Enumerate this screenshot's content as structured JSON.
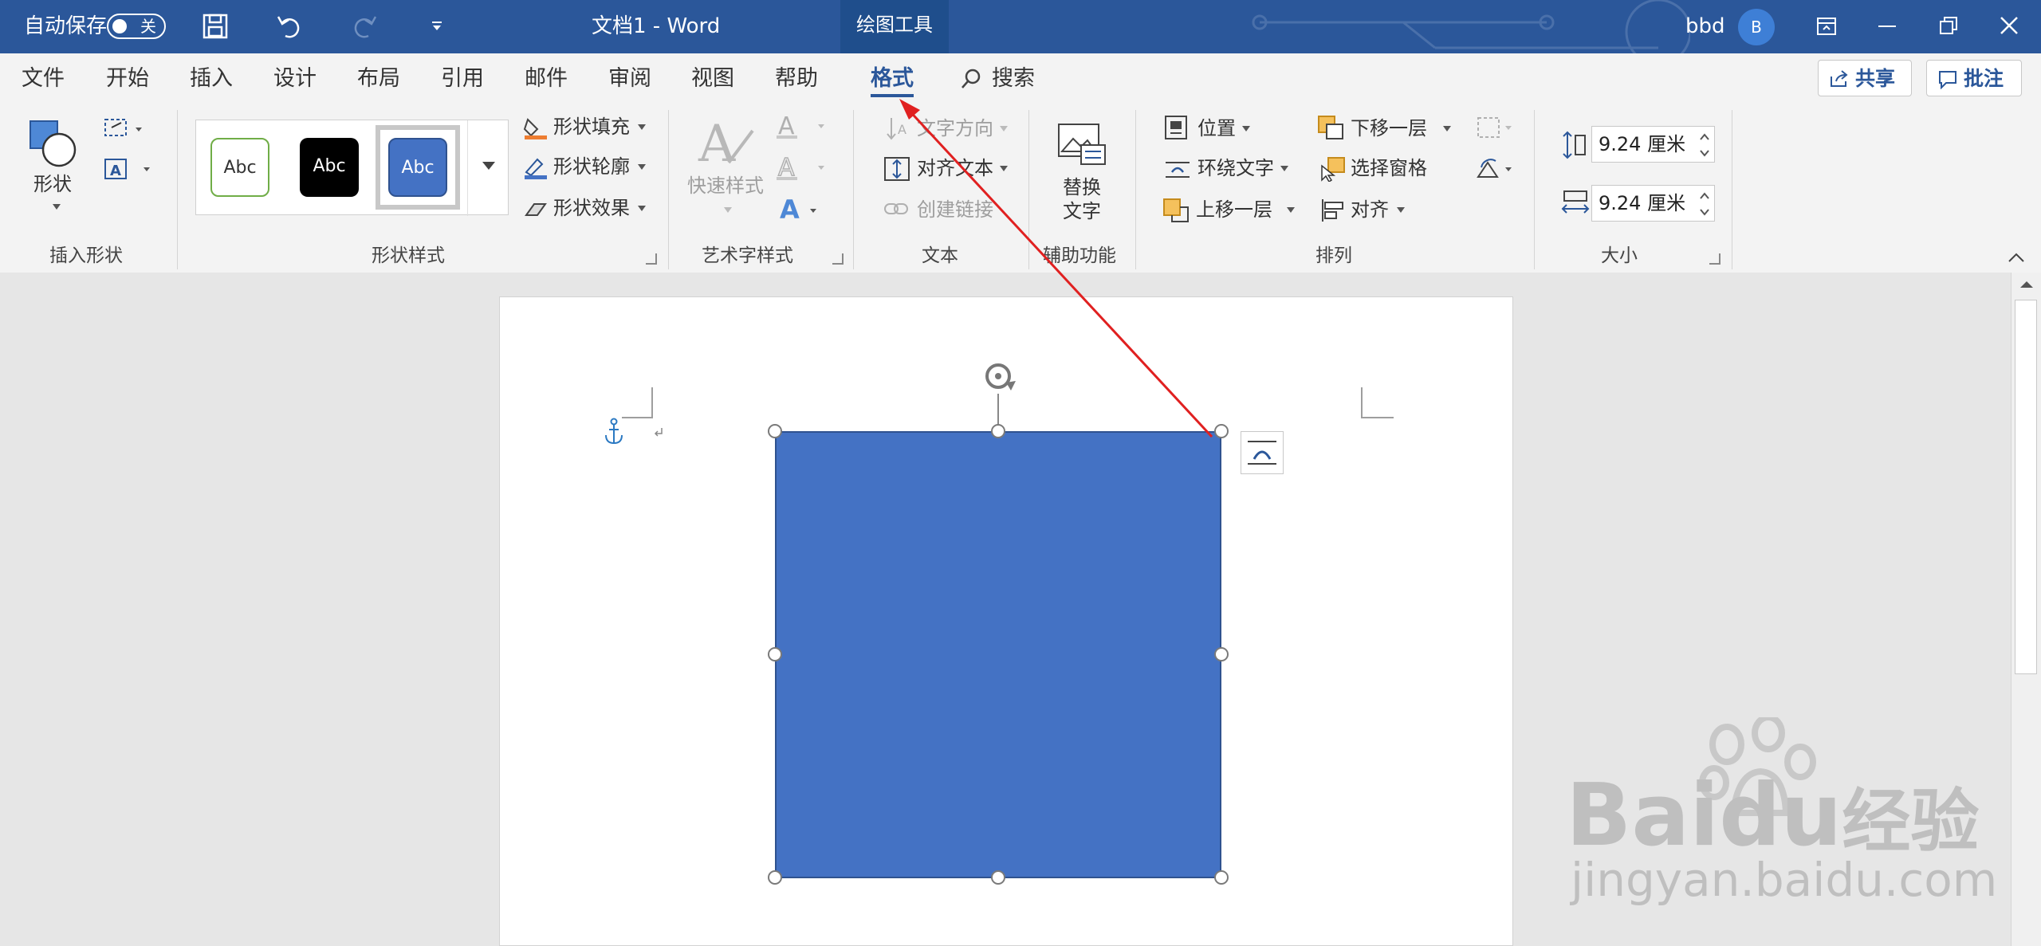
{
  "titlebar": {
    "autosave_label": "自动保存",
    "autosave_state": "关",
    "doc_title": "文档1  -  Word",
    "context_tab": "绘图工具",
    "user_name": "bbd",
    "avatar_initial": "B"
  },
  "menu": {
    "items": [
      "文件",
      "开始",
      "插入",
      "设计",
      "布局",
      "引用",
      "邮件",
      "审阅",
      "视图",
      "帮助",
      "格式"
    ],
    "search": "搜索",
    "share": "共享",
    "comment": "批注"
  },
  "ribbon": {
    "insert_shapes": {
      "label": "插入形状",
      "shape_btn": "形状"
    },
    "shape_styles": {
      "label": "形状样式",
      "swatch_text": "Abc",
      "fill": "形状填充",
      "outline": "形状轮廓",
      "effects": "形状效果"
    },
    "wordart": {
      "label": "艺术字样式",
      "quick_styles": "快速样式"
    },
    "text": {
      "label": "文本",
      "direction": "文字方向",
      "align": "对齐文本",
      "link": "创建链接"
    },
    "accessibility": {
      "label": "辅助功能",
      "alt_text_1": "替换",
      "alt_text_2": "文字"
    },
    "arrange": {
      "label": "排列",
      "position": "位置",
      "wrap": "环绕文字",
      "forward": "上移一层",
      "backward": "下移一层",
      "selection_pane": "选择窗格",
      "align": "对齐"
    },
    "size": {
      "label": "大小",
      "height": "9.24 厘米",
      "width": "9.24 厘米"
    }
  },
  "watermark": {
    "logo": "Bai",
    "logo2": "du",
    "cn": "经验",
    "url": "jingyan.baidu.com"
  },
  "colors": {
    "title_blue": "#2b579a",
    "shape_fill": "#4472c4",
    "arrow_red": "#e02020"
  }
}
